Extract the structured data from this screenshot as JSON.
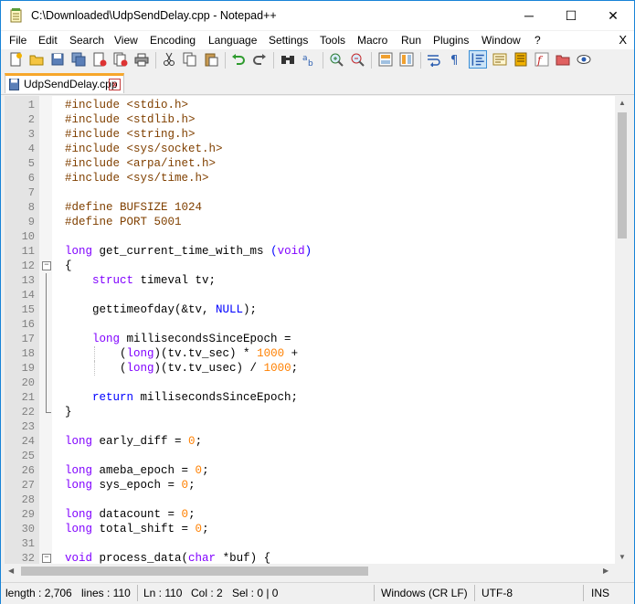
{
  "window": {
    "title": "C:\\Downloaded\\UdpSendDelay.cpp - Notepad++",
    "minimize_glyph": "─",
    "maximize_glyph": "☐",
    "close_glyph": "✕"
  },
  "menubar": {
    "items": [
      "File",
      "Edit",
      "Search",
      "View",
      "Encoding",
      "Language",
      "Settings",
      "Tools",
      "Macro",
      "Run",
      "Plugins",
      "Window",
      "?"
    ],
    "close_glyph": "X"
  },
  "toolbar": {
    "icons": [
      "new-file-icon",
      "open-file-icon",
      "save-icon",
      "save-all-icon",
      "close-file-icon",
      "close-all-icon",
      "print-icon",
      "cut-icon",
      "copy-icon",
      "paste-icon",
      "undo-icon",
      "redo-icon",
      "find-icon",
      "replace-icon",
      "zoom-in-icon",
      "zoom-out-icon",
      "sync-vertical-icon",
      "sync-horizontal-icon",
      "word-wrap-icon",
      "show-all-characters-icon",
      "indent-guide-icon",
      "user-defined-language-icon",
      "document-map-icon",
      "function-list-icon",
      "folder-workspace-icon",
      "monitoring-icon"
    ]
  },
  "tab": {
    "label": "UdpSendDelay.cpp",
    "close_glyph": "x"
  },
  "editor": {
    "lines": [
      {
        "n": "1",
        "t": "<span class=\"pp\">#include &lt;stdio.h&gt;</span>"
      },
      {
        "n": "2",
        "t": "<span class=\"pp\">#include &lt;stdlib.h&gt;</span>"
      },
      {
        "n": "3",
        "t": "<span class=\"pp\">#include &lt;string.h&gt;</span>"
      },
      {
        "n": "4",
        "t": "<span class=\"pp\">#include &lt;sys/socket.h&gt;</span>"
      },
      {
        "n": "5",
        "t": "<span class=\"pp\">#include &lt;arpa/inet.h&gt;</span>"
      },
      {
        "n": "6",
        "t": "<span class=\"pp\">#include &lt;sys/time.h&gt;</span>"
      },
      {
        "n": "7",
        "t": ""
      },
      {
        "n": "8",
        "t": "<span class=\"pp\">#define BUFSIZE 1024</span>"
      },
      {
        "n": "9",
        "t": "<span class=\"pp\">#define PORT 5001</span>"
      },
      {
        "n": "10",
        "t": ""
      },
      {
        "n": "11",
        "t": "<span class=\"ty\">long</span> get_current_time_with_ms <span class=\"kw\">(</span><span class=\"ty\">void</span><span class=\"kw\">)</span>"
      },
      {
        "n": "12",
        "t": "{"
      },
      {
        "n": "13",
        "t": "    <span class=\"ty\">struct</span> timeval tv;"
      },
      {
        "n": "14",
        "t": ""
      },
      {
        "n": "15",
        "t": "    gettimeofday(&amp;tv, <span class=\"kw\">NULL</span>);"
      },
      {
        "n": "16",
        "t": ""
      },
      {
        "n": "17",
        "t": "    <span class=\"ty\">long</span> millisecondsSinceEpoch ="
      },
      {
        "n": "18",
        "t": "        (<span class=\"ty\">long</span>)(tv.tv_sec) * <span class=\"num\">1000</span> +"
      },
      {
        "n": "19",
        "t": "        (<span class=\"ty\">long</span>)(tv.tv_usec) / <span class=\"num\">1000</span>;"
      },
      {
        "n": "20",
        "t": ""
      },
      {
        "n": "21",
        "t": "    <span class=\"kw\">return</span> millisecondsSinceEpoch;"
      },
      {
        "n": "22",
        "t": "}"
      },
      {
        "n": "23",
        "t": ""
      },
      {
        "n": "24",
        "t": "<span class=\"ty\">long</span> early_diff = <span class=\"num\">0</span>;"
      },
      {
        "n": "25",
        "t": ""
      },
      {
        "n": "26",
        "t": "<span class=\"ty\">long</span> ameba_epoch = <span class=\"num\">0</span>;"
      },
      {
        "n": "27",
        "t": "<span class=\"ty\">long</span> sys_epoch = <span class=\"num\">0</span>;"
      },
      {
        "n": "28",
        "t": ""
      },
      {
        "n": "29",
        "t": "<span class=\"ty\">long</span> datacount = <span class=\"num\">0</span>;"
      },
      {
        "n": "30",
        "t": "<span class=\"ty\">long</span> total_shift = <span class=\"num\">0</span>;"
      },
      {
        "n": "31",
        "t": ""
      },
      {
        "n": "32",
        "t": "<span class=\"ty\">void</span> process_data(<span class=\"ty\">char</span> *buf) {"
      }
    ]
  },
  "statusbar": {
    "length": "length : 2,706",
    "lines": "lines : 110",
    "ln": "Ln : 110",
    "col": "Col : 2",
    "sel": "Sel : 0 | 0",
    "eol": "Windows (CR LF)",
    "encoding": "UTF-8",
    "mode": "INS"
  }
}
